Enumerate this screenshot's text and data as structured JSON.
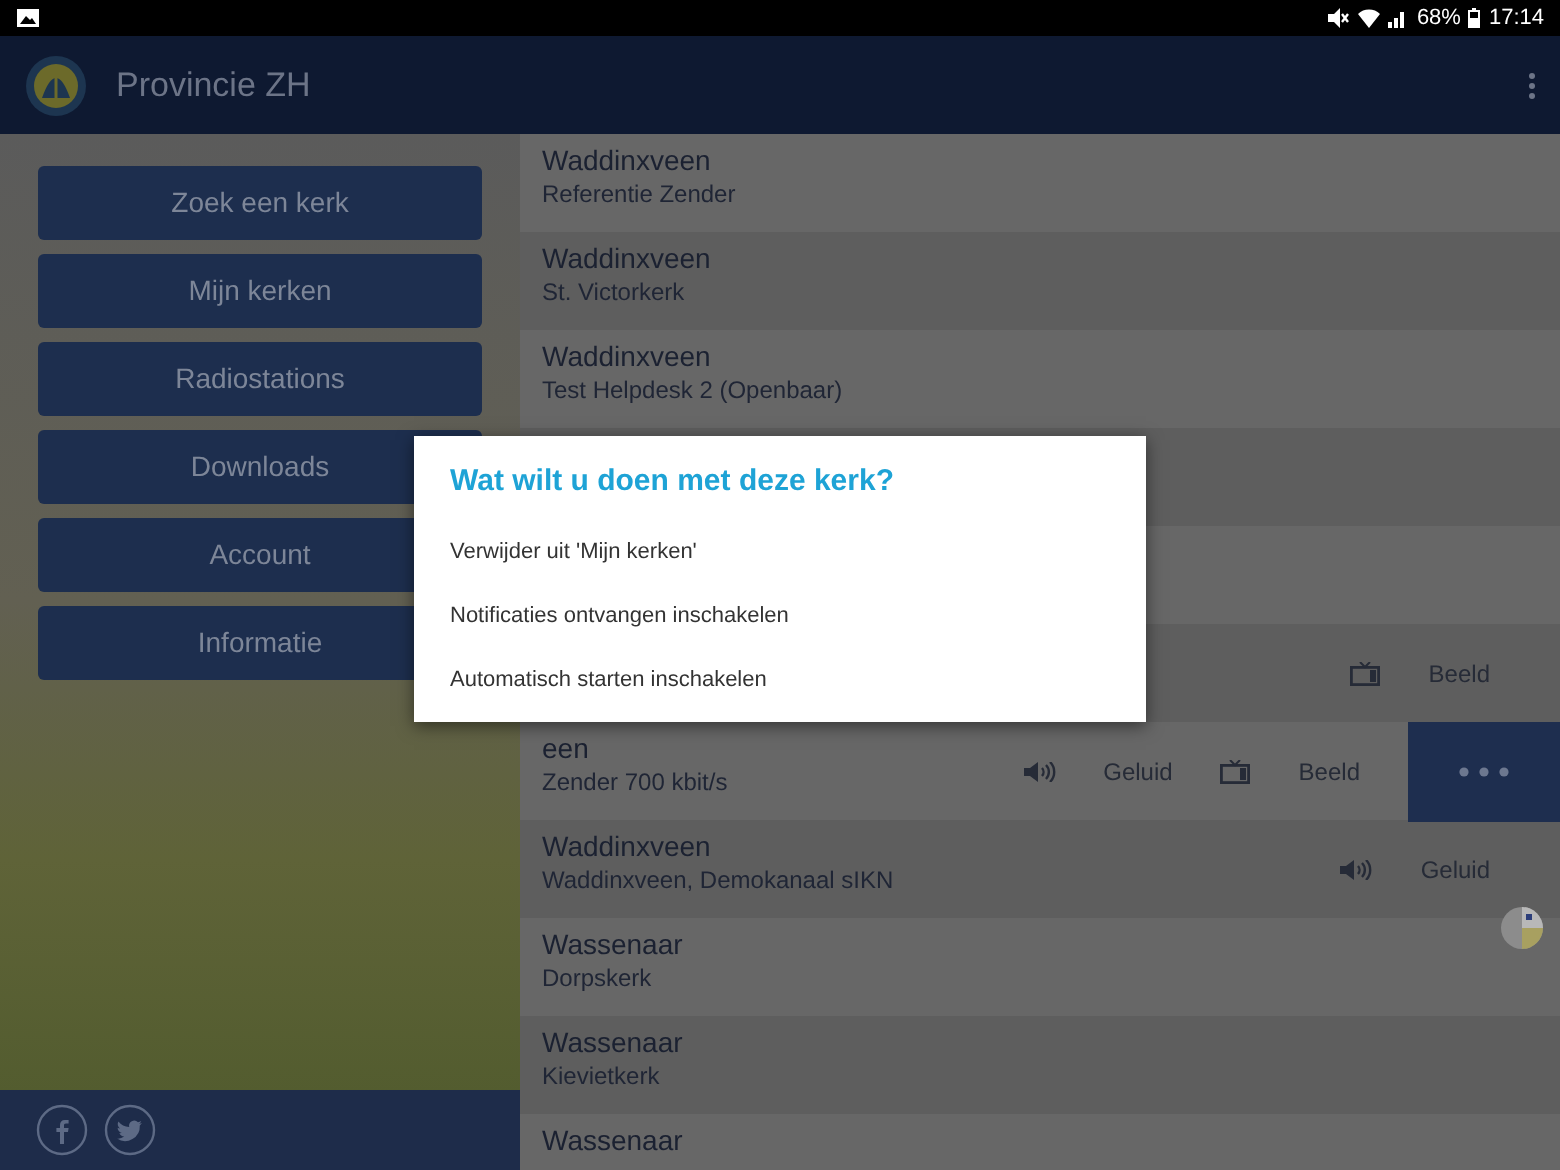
{
  "status_bar": {
    "battery": "68%",
    "time": "17:14"
  },
  "app_bar": {
    "title": "Provincie ZH"
  },
  "menu": [
    {
      "label": "Zoek een kerk"
    },
    {
      "label": "Mijn kerken"
    },
    {
      "label": "Radiostations"
    },
    {
      "label": "Downloads"
    },
    {
      "label": "Account"
    },
    {
      "label": "Informatie"
    }
  ],
  "churches": [
    {
      "title": "Waddinxveen",
      "subtitle": "Referentie Zender",
      "selected": false
    },
    {
      "title": "Waddinxveen",
      "subtitle": "St. Victorkerk",
      "selected": false
    },
    {
      "title": "Waddinxveen",
      "subtitle": "Test Helpdesk 2 (Openbaar)",
      "selected": false
    },
    {
      "selected": false
    },
    {
      "selected": false
    },
    {
      "selected": false,
      "actions": [
        {
          "kind": "video",
          "label": "Beeld"
        }
      ]
    },
    {
      "title": "een",
      "subtitle": "Zender 700 kbit/s",
      "selected": true,
      "actions": [
        {
          "kind": "audio",
          "label": "Geluid"
        },
        {
          "kind": "video",
          "label": "Beeld"
        }
      ]
    },
    {
      "title": "Waddinxveen",
      "subtitle": "Waddinxveen, Demokanaal sIKN",
      "selected": false,
      "actions": [
        {
          "kind": "audio",
          "label": "Geluid"
        }
      ]
    },
    {
      "title": "Wassenaar",
      "subtitle": "Dorpskerk",
      "selected": false
    },
    {
      "title": "Wassenaar",
      "subtitle": "Kievietkerk",
      "selected": false
    },
    {
      "title": "Wassenaar",
      "selected": false
    }
  ],
  "dialog": {
    "title": "Wat wilt u doen met deze kerk?",
    "options": [
      "Verwijder uit 'Mijn kerken'",
      "Notificaties ontvangen inschakelen",
      "Automatisch starten inschakelen"
    ]
  }
}
